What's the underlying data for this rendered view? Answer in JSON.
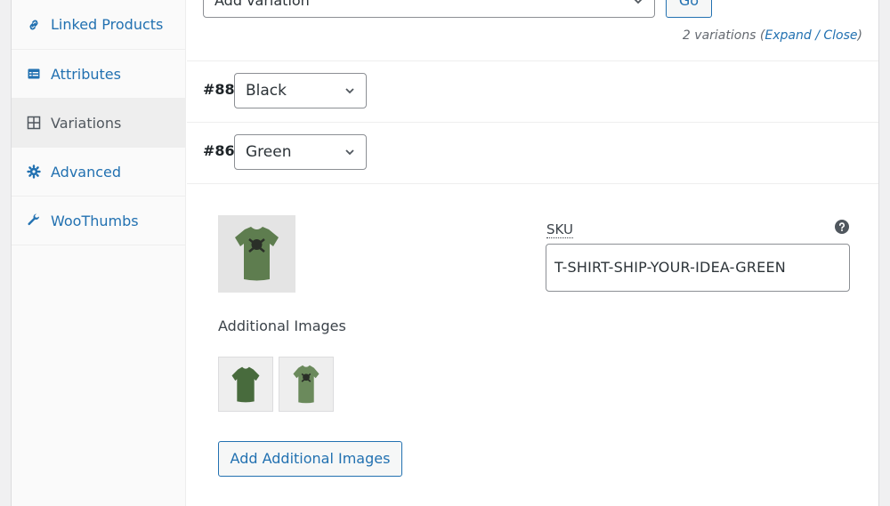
{
  "sidebar": {
    "items": [
      {
        "label": "Linked Products",
        "icon": "link-icon"
      },
      {
        "label": "Attributes",
        "icon": "list-table-icon"
      },
      {
        "label": "Variations",
        "icon": "grid-icon",
        "active": true
      },
      {
        "label": "Advanced",
        "icon": "gear-icon"
      },
      {
        "label": "WooThumbs",
        "icon": "wrench-icon"
      }
    ]
  },
  "toolbar": {
    "add_select_value": "Add variation",
    "go_label": "Go",
    "count_text": "2 variations",
    "expand_label": "Expand",
    "separator": "/",
    "close_label": "Close"
  },
  "variations": [
    {
      "id": "#88",
      "selected": "Black"
    },
    {
      "id": "#86",
      "selected": "Green"
    }
  ],
  "detail": {
    "additional_images_label": "Additional Images",
    "add_images_button": "Add Additional Images",
    "sku_label": "SKU",
    "sku_value": "T-SHIRT-SHIP-YOUR-IDEA-GREEN"
  },
  "colors": {
    "accent": "#2271b1",
    "shirt_green": "#5e7d4f"
  }
}
